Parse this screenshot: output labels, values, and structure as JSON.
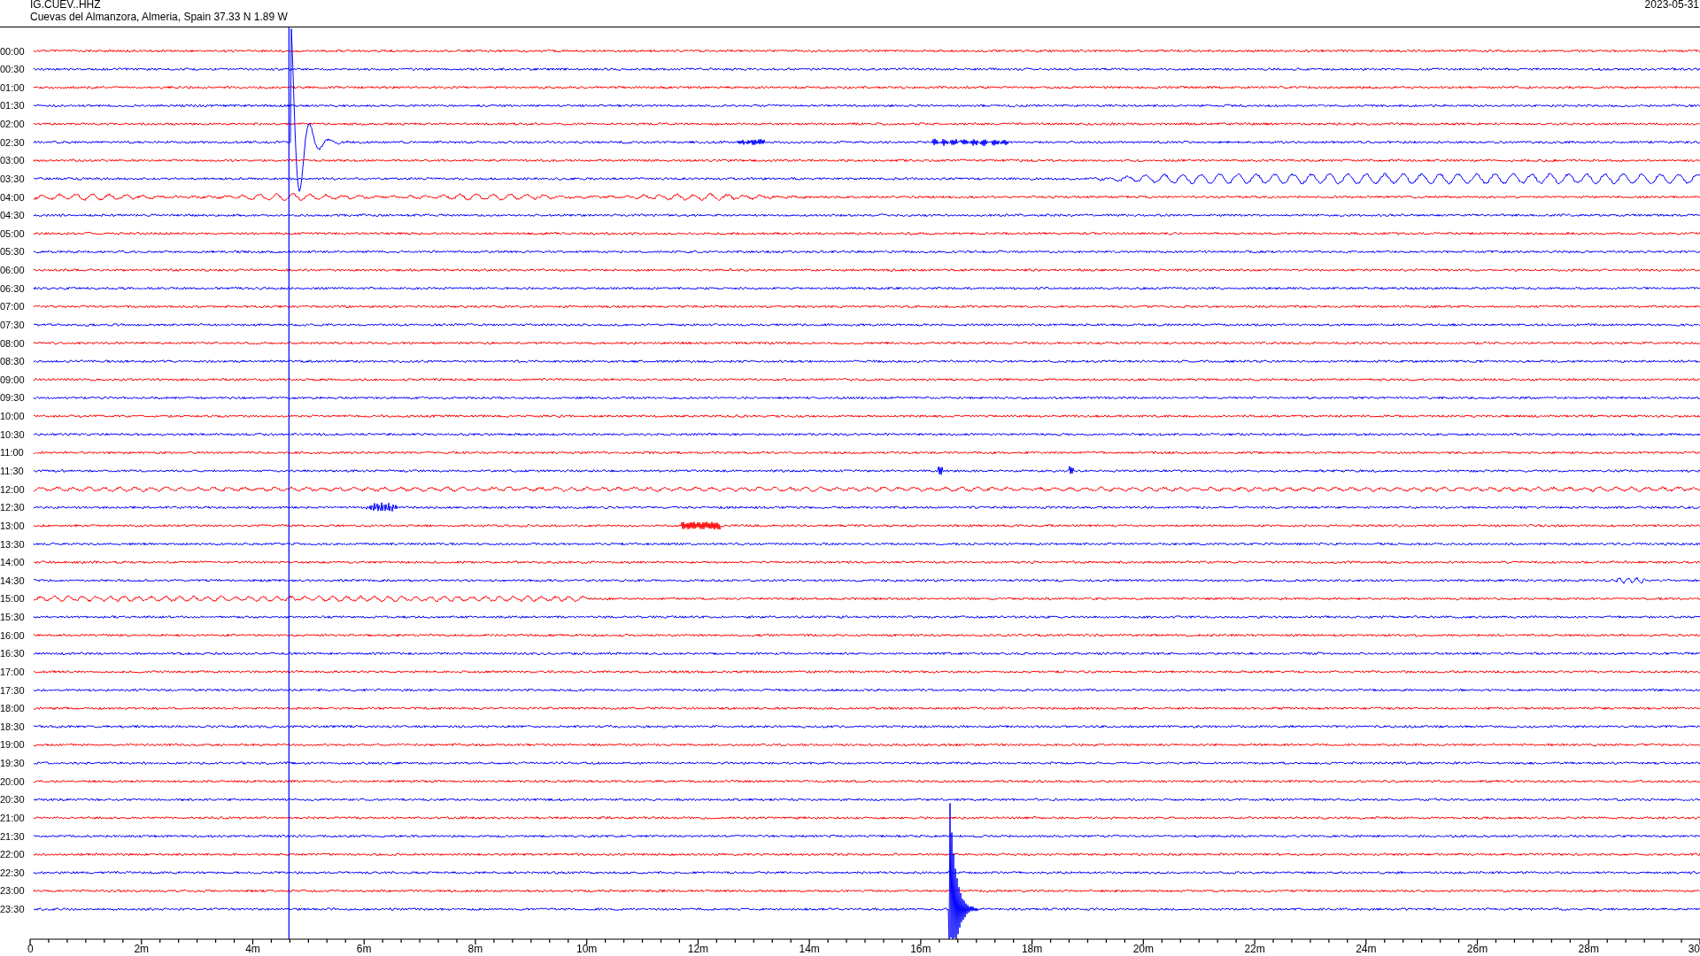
{
  "header": {
    "station": "IG.CUEV..HHZ",
    "location": "Cuevas del Almanzora, Almeria, Spain  37.33 N 1.89 W",
    "date": "2023-05-31"
  },
  "rows": [
    {
      "time": "00:00",
      "color": "#ff0000"
    },
    {
      "time": "00:30",
      "color": "#0000ff"
    },
    {
      "time": "01:00",
      "color": "#ff0000"
    },
    {
      "time": "01:30",
      "color": "#0000ff"
    },
    {
      "time": "02:00",
      "color": "#ff0000"
    },
    {
      "time": "02:30",
      "color": "#0000ff"
    },
    {
      "time": "03:00",
      "color": "#ff0000"
    },
    {
      "time": "03:30",
      "color": "#0000ff"
    },
    {
      "time": "04:00",
      "color": "#ff0000"
    },
    {
      "time": "04:30",
      "color": "#0000ff"
    },
    {
      "time": "05:00",
      "color": "#ff0000"
    },
    {
      "time": "05:30",
      "color": "#0000ff"
    },
    {
      "time": "06:00",
      "color": "#ff0000"
    },
    {
      "time": "06:30",
      "color": "#0000ff"
    },
    {
      "time": "07:00",
      "color": "#ff0000"
    },
    {
      "time": "07:30",
      "color": "#0000ff"
    },
    {
      "time": "08:00",
      "color": "#ff0000"
    },
    {
      "time": "08:30",
      "color": "#0000ff"
    },
    {
      "time": "09:00",
      "color": "#ff0000"
    },
    {
      "time": "09:30",
      "color": "#0000ff"
    },
    {
      "time": "10:00",
      "color": "#ff0000"
    },
    {
      "time": "10:30",
      "color": "#0000ff"
    },
    {
      "time": "11:00",
      "color": "#ff0000"
    },
    {
      "time": "11:30",
      "color": "#0000ff"
    },
    {
      "time": "12:00",
      "color": "#ff0000"
    },
    {
      "time": "12:30",
      "color": "#0000ff"
    },
    {
      "time": "13:00",
      "color": "#ff0000"
    },
    {
      "time": "13:30",
      "color": "#0000ff"
    },
    {
      "time": "14:00",
      "color": "#ff0000"
    },
    {
      "time": "14:30",
      "color": "#0000ff"
    },
    {
      "time": "15:00",
      "color": "#ff0000"
    },
    {
      "time": "15:30",
      "color": "#0000ff"
    },
    {
      "time": "16:00",
      "color": "#ff0000"
    },
    {
      "time": "16:30",
      "color": "#0000ff"
    },
    {
      "time": "17:00",
      "color": "#ff0000"
    },
    {
      "time": "17:30",
      "color": "#0000ff"
    },
    {
      "time": "18:00",
      "color": "#ff0000"
    },
    {
      "time": "18:30",
      "color": "#0000ff"
    },
    {
      "time": "19:00",
      "color": "#ff0000"
    },
    {
      "time": "19:30",
      "color": "#0000ff"
    },
    {
      "time": "20:00",
      "color": "#ff0000"
    },
    {
      "time": "20:30",
      "color": "#0000ff"
    },
    {
      "time": "21:00",
      "color": "#ff0000"
    },
    {
      "time": "21:30",
      "color": "#0000ff"
    },
    {
      "time": "22:00",
      "color": "#ff0000"
    },
    {
      "time": "22:30",
      "color": "#0000ff"
    },
    {
      "time": "23:00",
      "color": "#ff0000"
    },
    {
      "time": "23:30",
      "color": "#0000ff"
    }
  ],
  "x_axis": {
    "tick_labels": [
      "0",
      "2m",
      "4m",
      "6m",
      "8m",
      "10m",
      "12m",
      "14m",
      "16m",
      "18m",
      "20m",
      "22m",
      "24m",
      "26m",
      "28m",
      "30"
    ]
  }
}
